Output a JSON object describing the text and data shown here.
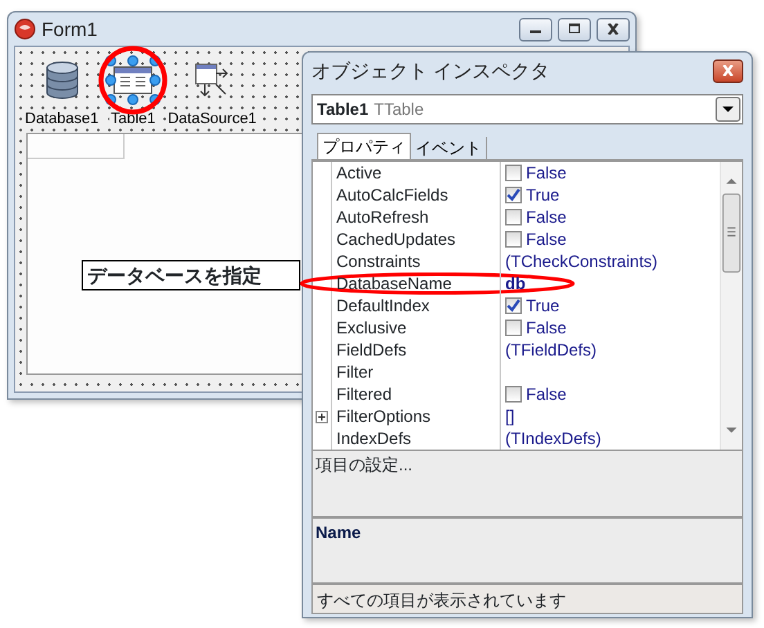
{
  "form": {
    "title": "Form1",
    "components": [
      {
        "label": "Database1",
        "kind": "database",
        "selected": false,
        "annotated": false
      },
      {
        "label": "Table1",
        "kind": "table",
        "selected": true,
        "annotated": true
      },
      {
        "label": "DataSource1",
        "kind": "datasource",
        "selected": false,
        "annotated": false
      }
    ],
    "label": "データベースを指定"
  },
  "inspector": {
    "title": "オブジェクト インスペクタ",
    "object_name": "Table1",
    "object_type": "TTable",
    "tabs": [
      {
        "label": "プロパティ",
        "selected": true
      },
      {
        "label": "イベント",
        "selected": false
      }
    ],
    "properties": [
      {
        "name": "Active",
        "kind": "bool",
        "value": "False",
        "checked": false
      },
      {
        "name": "AutoCalcFields",
        "kind": "bool",
        "value": "True",
        "checked": true
      },
      {
        "name": "AutoRefresh",
        "kind": "bool",
        "value": "False",
        "checked": false
      },
      {
        "name": "CachedUpdates",
        "kind": "bool",
        "value": "False",
        "checked": false
      },
      {
        "name": "Constraints",
        "kind": "text",
        "value": "(TCheckConstraints)"
      },
      {
        "name": "DatabaseName",
        "kind": "bold",
        "value": "db",
        "annotated": true
      },
      {
        "name": "DefaultIndex",
        "kind": "bool",
        "value": "True",
        "checked": true
      },
      {
        "name": "Exclusive",
        "kind": "bool",
        "value": "False",
        "checked": false
      },
      {
        "name": "FieldDefs",
        "kind": "text",
        "value": "(TFieldDefs)"
      },
      {
        "name": "Filter",
        "kind": "text"
      },
      {
        "name": "Filtered",
        "kind": "bool",
        "value": "False",
        "checked": false
      },
      {
        "name": "FilterOptions",
        "kind": "text",
        "value": "[]",
        "expandable": true
      },
      {
        "name": "IndexDefs",
        "kind": "text",
        "value": "(TIndexDefs)"
      }
    ],
    "description": "項目の設定...",
    "help_title": "Name",
    "status": "すべての項目が表示されています"
  }
}
